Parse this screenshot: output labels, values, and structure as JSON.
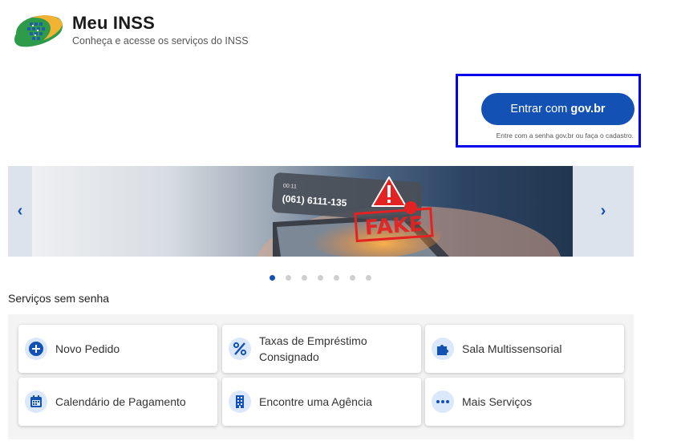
{
  "header": {
    "title": "Meu INSS",
    "subtitle": "Conheça e acesse os serviços do INSS"
  },
  "login": {
    "button_prefix": "Entrar com",
    "button_brand": "gov.br",
    "hint": "Entre com a senha gov.br ou faça o cadastro."
  },
  "carousel": {
    "prev_label": "‹",
    "next_label": "›",
    "slide": {
      "call_time": "00:11",
      "phone": "(061) 6111-135",
      "stamp": "FAKE"
    },
    "dot_count": 7,
    "active_dot": 0
  },
  "services": {
    "title": "Serviços sem senha",
    "items": [
      {
        "label": "Novo Pedido",
        "icon": "plus-circle-icon"
      },
      {
        "label": "Taxas de Empréstimo Consignado",
        "icon": "percent-icon"
      },
      {
        "label": "Sala Multissensorial",
        "icon": "puzzle-icon"
      },
      {
        "label": "Calendário de Pagamento",
        "icon": "calendar-icon"
      },
      {
        "label": "Encontre uma Agência",
        "icon": "building-icon"
      },
      {
        "label": "Mais Serviços",
        "icon": "ellipsis-icon"
      }
    ]
  },
  "colors": {
    "primary": "#1351b4",
    "highlight": "#0000ee",
    "icon_bg": "#dbe8fb",
    "fake_red": "#e52222"
  }
}
